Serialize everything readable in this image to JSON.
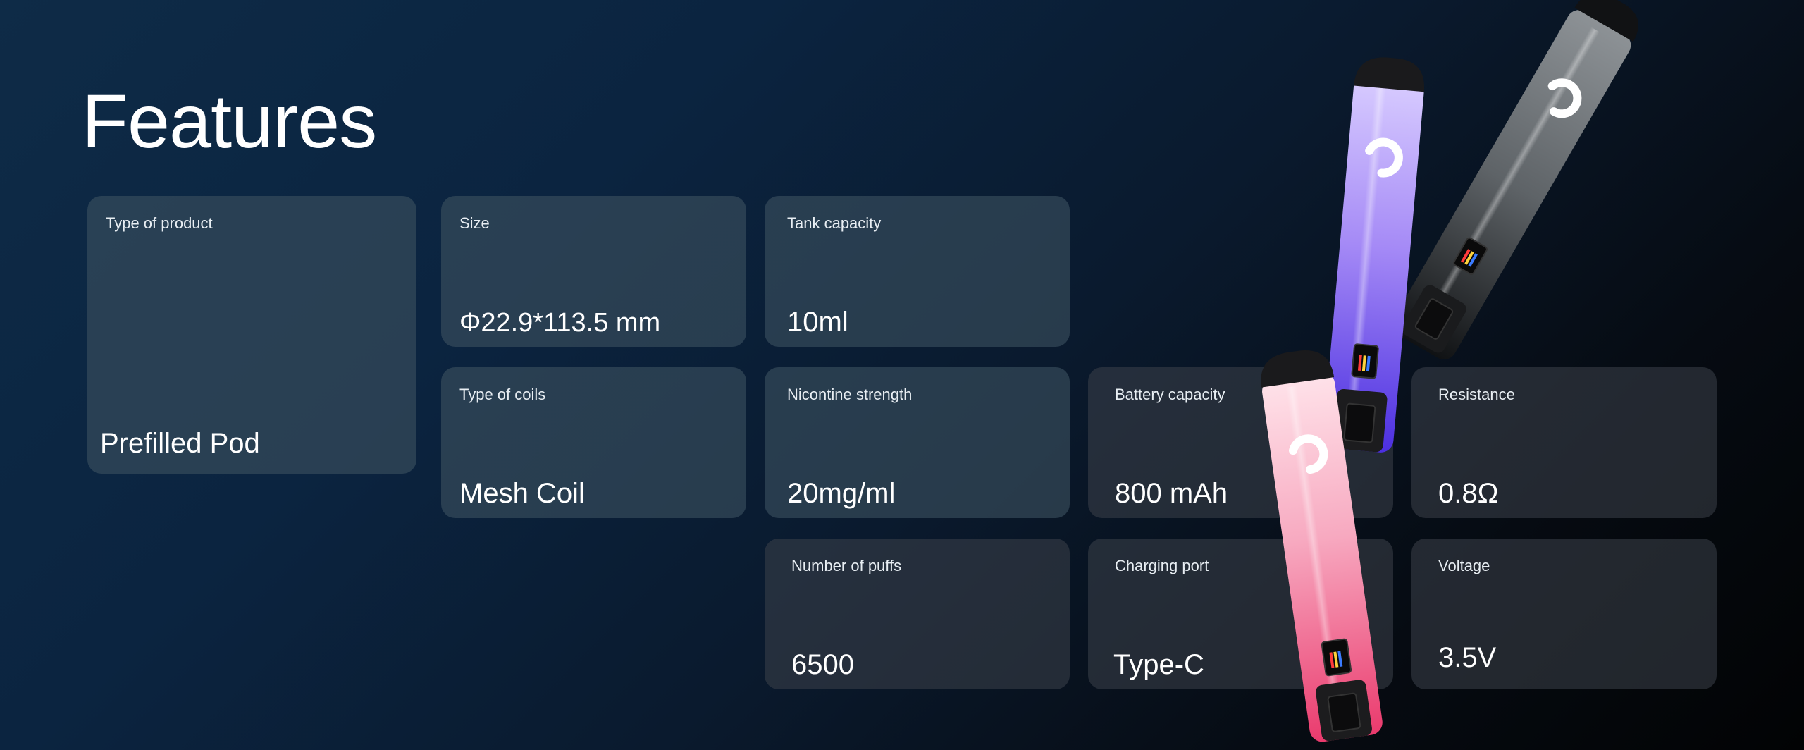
{
  "page": {
    "title": "Features"
  },
  "cards": {
    "type_of_product": {
      "label": "Type of product",
      "value": "Prefilled Pod"
    },
    "size": {
      "label": "Size",
      "value": "Φ22.9*113.5 mm"
    },
    "tank_capacity": {
      "label": "Tank capacity",
      "value": "10ml"
    },
    "type_of_coils": {
      "label": "Type of coils",
      "value": "Mesh Coil"
    },
    "nicotine_strength": {
      "label": "Nicontine strength",
      "value": "20mg/ml"
    },
    "battery_capacity": {
      "label": "Battery capacity",
      "value": "800 mAh"
    },
    "resistance": {
      "label": "Resistance",
      "value": "0.8Ω"
    },
    "number_of_puffs": {
      "label": "Number of puffs",
      "value": "6500"
    },
    "charging_port": {
      "label": "Charging port",
      "value": "Type-C"
    },
    "voltage": {
      "label": "Voltage",
      "value": "3.5V"
    }
  },
  "colors": {
    "device_purple": "#8a6cf0",
    "device_grey": "#6f7478",
    "device_pink": "#f06f9a"
  }
}
